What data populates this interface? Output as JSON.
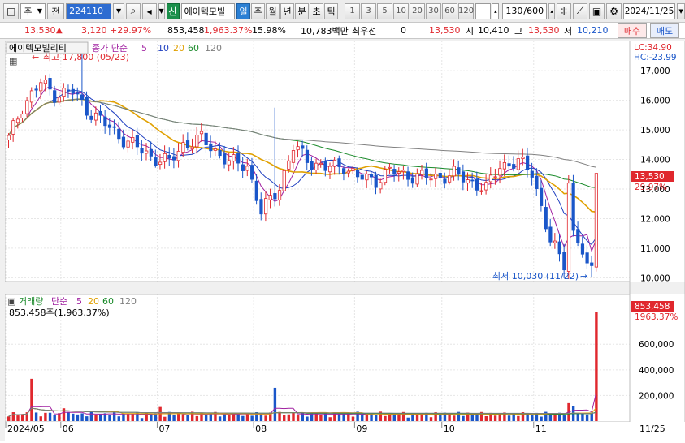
{
  "toolbar": {
    "market_type": "주",
    "prev_label": "전",
    "stock_code": "224110",
    "badge": "신",
    "stock_name": "에이텍모빌",
    "period_tabs": [
      "일",
      "주",
      "월",
      "년",
      "분",
      "초",
      "틱"
    ],
    "period_active": "일",
    "minute_steps": [
      "1",
      "3",
      "5",
      "10",
      "20",
      "30",
      "60",
      "120"
    ],
    "count_value": "130",
    "count_max": "/600",
    "date": "2024/11/25"
  },
  "quote": {
    "price": "13,530",
    "change": "3,120",
    "change_pct": "+29.97%",
    "volume": "853,458",
    "volume_pct": "1,963.37%",
    "turnover": "15.98%",
    "amount": "10,783백만",
    "pref_label": "최우선",
    "pref_value": "0",
    "ask_quote": "13,530",
    "open_label": "시",
    "open_value": "10,410",
    "high_label": "고",
    "high_value": "13,530",
    "low_label": "저",
    "low_value": "10,210",
    "buy_label": "매수",
    "sell_label": "매도"
  },
  "price_panel": {
    "title": "에이텍모빌리티",
    "ma_label": "종가 단순",
    "ma_periods": [
      "5",
      "10",
      "20",
      "60",
      "120"
    ],
    "lc_label": "LC:34.90",
    "hc_label": "HC:-23.99",
    "high_annotation": "최고 17,800 (05/23)",
    "low_annotation": "최저 10,030 (11/22)",
    "last_price_tag": "13,530",
    "last_change_tag": "29.97%",
    "y_ticks": [
      "17,000",
      "16,000",
      "15,000",
      "14,000",
      "13,000",
      "12,000",
      "11,000",
      "10,000"
    ]
  },
  "volume_panel": {
    "title": "거래량",
    "ma_label": "단순",
    "ma_periods": [
      "5",
      "20",
      "60",
      "120"
    ],
    "value_line": "853,458주(1,963.37%)",
    "last_volume_tag": "853,458",
    "last_pct_tag": "1963.37%",
    "y_ticks": [
      "600,000",
      "400,000",
      "200,000"
    ]
  },
  "x_axis": {
    "labels": [
      "2024/05",
      "06",
      "07",
      "08",
      "09",
      "10",
      "11"
    ],
    "right_label": "11/25"
  },
  "colors": {
    "up": "#e0282e",
    "down": "#1a56c9",
    "ma5": "#a020a0",
    "ma10": "#2040c0",
    "ma20": "#e0a000",
    "ma60": "#1a8a2a",
    "ma120": "#808080"
  },
  "chart_data": {
    "type": "candlestick",
    "close_points": [
      [
        "05/16",
        14700
      ],
      [
        "05/20",
        15800
      ],
      [
        "05/23",
        16600
      ],
      [
        "05/28",
        16200
      ],
      [
        "05/31",
        16300
      ],
      [
        "06/05",
        15700
      ],
      [
        "06/10",
        15200
      ],
      [
        "06/14",
        14800
      ],
      [
        "06/20",
        14400
      ],
      [
        "06/26",
        14100
      ],
      [
        "07/02",
        13900
      ],
      [
        "07/08",
        14500
      ],
      [
        "07/12",
        14700
      ],
      [
        "07/18",
        14300
      ],
      [
        "07/24",
        13900
      ],
      [
        "07/30",
        13800
      ],
      [
        "08/05",
        12200
      ],
      [
        "08/08",
        13100
      ],
      [
        "08/13",
        14400
      ],
      [
        "08/19",
        13900
      ],
      [
        "08/23",
        13700
      ],
      [
        "08/29",
        13800
      ],
      [
        "09/04",
        13400
      ],
      [
        "09/10",
        13300
      ],
      [
        "09/20",
        13600
      ],
      [
        "09/26",
        13500
      ],
      [
        "10/02",
        13400
      ],
      [
        "10/08",
        13400
      ],
      [
        "10/14",
        13500
      ],
      [
        "10/18",
        13300
      ],
      [
        "10/24",
        13000
      ],
      [
        "10/30",
        13800
      ],
      [
        "11/05",
        13900
      ],
      [
        "11/11",
        13600
      ],
      [
        "11/15",
        11200
      ],
      [
        "11/20",
        10500
      ],
      [
        "11/22",
        10410
      ],
      [
        "11/25",
        13530
      ]
    ],
    "high": 17800,
    "high_date": "05/23",
    "low": 10030,
    "low_date": "11/22",
    "last_close": 13530,
    "volume_last": 853458,
    "ylim_price": [
      9900,
      17800
    ],
    "ylim_volume": [
      0,
      880000
    ]
  }
}
